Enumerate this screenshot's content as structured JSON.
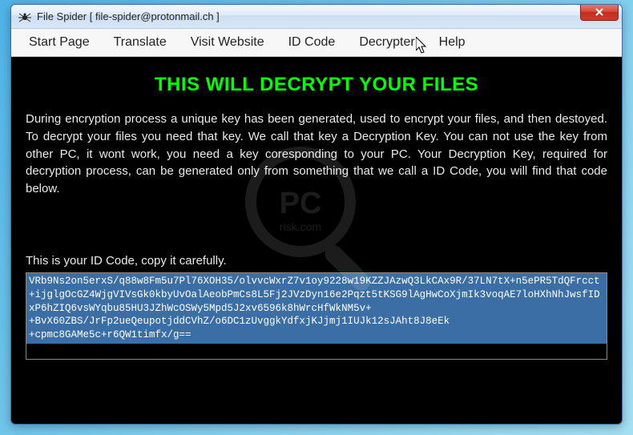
{
  "titlebar": {
    "title": "File Spider [ file-spider@protonmail.ch ]"
  },
  "menu": {
    "items": [
      "Start Page",
      "Translate",
      "Visit Website",
      "ID Code",
      "Decrypter",
      "Help"
    ]
  },
  "content": {
    "headline": "THIS WILL DECRYPT YOUR FILES",
    "paragraph": "During encryption process a unique key has been generated, used to encrypt your files, and then destoyed. To decrypt your files you need that key. We call that key a Decryption Key. You can not use the key from other PC, it wont work, you need a key coresponding to your PC. Your Decryption Key, required for decryption process, can be generated only from something that we call a ID Code, you will find that code below.",
    "id_label": "This is your ID Code, copy it carefully.",
    "id_code": "VRb9Ns2on5erxS/q88w8Fm5u7Pl76XOH35/olvvcWxrZ7v1oy9228w19KZZJAzwQ3LkCAx9R/37LN7tX+n5ePR5TdQFrcct\n+ijglgOcGZ4WjgVIVsGk0kbyUvOalAeobPmCs8L5Fj2JVzDyn16e2Pqzt5tKSG9lAgHwCoXjmIk3voqAE7loHXhNhJwsfIDxP6hZIQ6vsWYqbu85HU3JZhWcOSWy5Mpd5J2xv6596k8hWrcHfWkNM5v+\n+BvX60ZBS/JrFp2ueQeupotjddCVhZ/o6DC1zUvggkYdfxjKJjmj1IUJk12sJAht8J8eEk\n+cpmc8GAMe5c+r6QW1timfx/g=="
  }
}
